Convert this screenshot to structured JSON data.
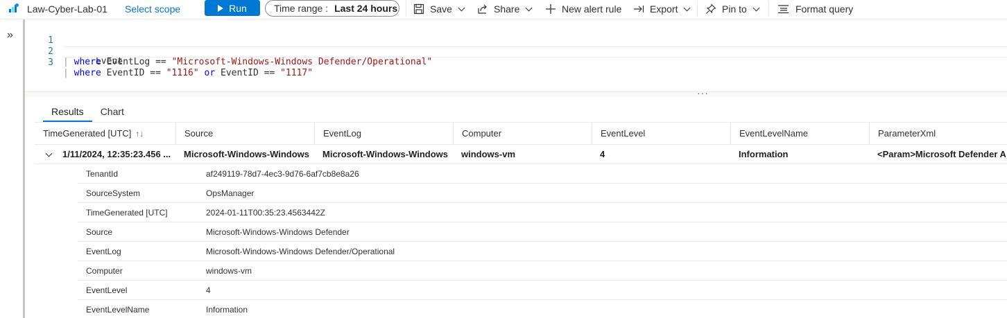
{
  "toolbar": {
    "workspace_name": "Law-Cyber-Lab-01",
    "select_scope": "Select scope",
    "run_label": "Run",
    "time_range_label": "Time range :",
    "time_range_value": "Last 24 hours",
    "save_label": "Save",
    "share_label": "Share",
    "new_alert_label": "New alert rule",
    "export_label": "Export",
    "pin_label": "Pin to",
    "format_label": "Format query"
  },
  "editor": {
    "lines": [
      {
        "num": "1",
        "parts": [
          "Event"
        ]
      },
      {
        "num": "2",
        "parts": [
          "| ",
          "where",
          " EventLog == ",
          "\"Microsoft-Windows-Windows Defender/Operational\""
        ]
      },
      {
        "num": "3",
        "parts": [
          "| ",
          "where",
          " EventID == ",
          "\"1116\"",
          " ",
          "or",
          " EventID == ",
          "\"1117\""
        ]
      }
    ]
  },
  "results": {
    "tabs": [
      "Results",
      "Chart"
    ],
    "columns": [
      "TimeGenerated [UTC]",
      "Source",
      "EventLog",
      "Computer",
      "EventLevel",
      "EventLevelName",
      "ParameterXml"
    ],
    "row": [
      "1/11/2024, 12:35:23.456 ...",
      "Microsoft-Windows-Windows ...",
      "Microsoft-Windows-Windows ...",
      "windows-vm",
      "4",
      "Information",
      "<Param>Microsoft Defender A..."
    ],
    "details": [
      {
        "key": "TenantId",
        "value": "af249119-78d7-4ec3-9d76-6af7cb8e8a26"
      },
      {
        "key": "SourceSystem",
        "value": "OpsManager"
      },
      {
        "key": "TimeGenerated [UTC]",
        "value": "2024-01-11T00:35:23.4563442Z"
      },
      {
        "key": "Source",
        "value": "Microsoft-Windows-Windows Defender"
      },
      {
        "key": "EventLog",
        "value": "Microsoft-Windows-Windows Defender/Operational"
      },
      {
        "key": "Computer",
        "value": "windows-vm"
      },
      {
        "key": "EventLevel",
        "value": "4"
      },
      {
        "key": "EventLevelName",
        "value": "Information"
      }
    ]
  },
  "colors": {
    "accent": "#0078d4",
    "keyword": "#0000ff",
    "string": "#a31515",
    "line_number": "#237893"
  }
}
